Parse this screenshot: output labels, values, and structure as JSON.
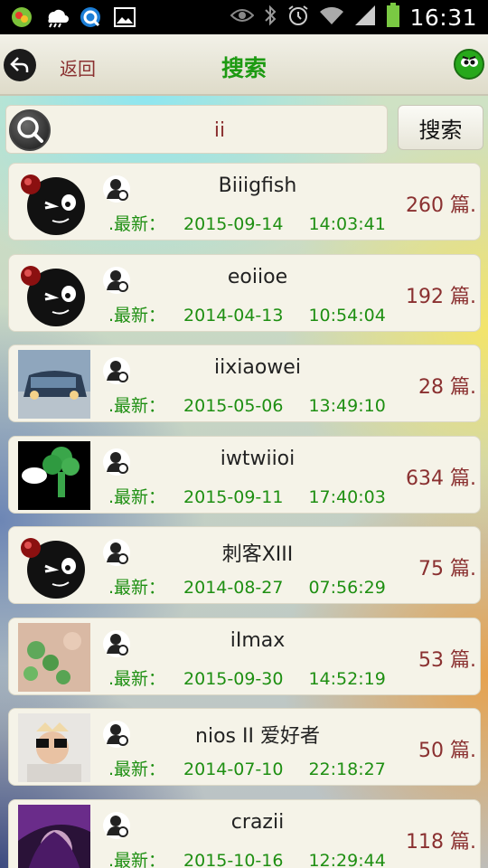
{
  "status_bar": {
    "time": "16:31",
    "icons": [
      "app-notification-icon",
      "cloud-icon",
      "browser-icon",
      "image-icon",
      "eye-icon",
      "bluetooth-icon",
      "alarm-icon",
      "wifi-icon",
      "signal-icon",
      "battery-icon"
    ]
  },
  "title_bar": {
    "back_label": "返回",
    "title": "搜索"
  },
  "search": {
    "value": "ii",
    "button_label": "搜索"
  },
  "colors": {
    "accent_green": "#1d9a12",
    "count_red": "#8a3030"
  },
  "list": {
    "latest_label": ".最新：",
    "items": [
      {
        "name": "Biiigfish",
        "date": "2015-09-14",
        "time": "14:03:41",
        "count": "260 篇.",
        "avatar": "bomb-avatar"
      },
      {
        "name": "eoiioe",
        "date": "2014-04-13",
        "time": "10:54:04",
        "count": "192 篇.",
        "avatar": "bomb-avatar"
      },
      {
        "name": "iixiaowei",
        "date": "2015-05-06",
        "time": "13:49:10",
        "count": "28 篇.",
        "avatar": "car-photo-avatar"
      },
      {
        "name": "iwtwiioi",
        "date": "2015-09-11",
        "time": "17:40:03",
        "count": "634 篇.",
        "avatar": "broccoli-avatar"
      },
      {
        "name": "刺客XIII",
        "date": "2014-08-27",
        "time": "07:56:29",
        "count": "75 篇.",
        "avatar": "bomb-avatar"
      },
      {
        "name": "iImax",
        "date": "2015-09-30",
        "time": "14:52:19",
        "count": "53 篇.",
        "avatar": "leaves-photo-avatar"
      },
      {
        "name": "nios II 爱好者",
        "date": "2014-07-10",
        "time": "22:18:27",
        "count": "50 篇.",
        "avatar": "baby-photo-avatar"
      },
      {
        "name": "crazii",
        "date": "2015-10-16",
        "time": "12:29:44",
        "count": "118 篇.",
        "avatar": "anime-avatar"
      }
    ]
  }
}
